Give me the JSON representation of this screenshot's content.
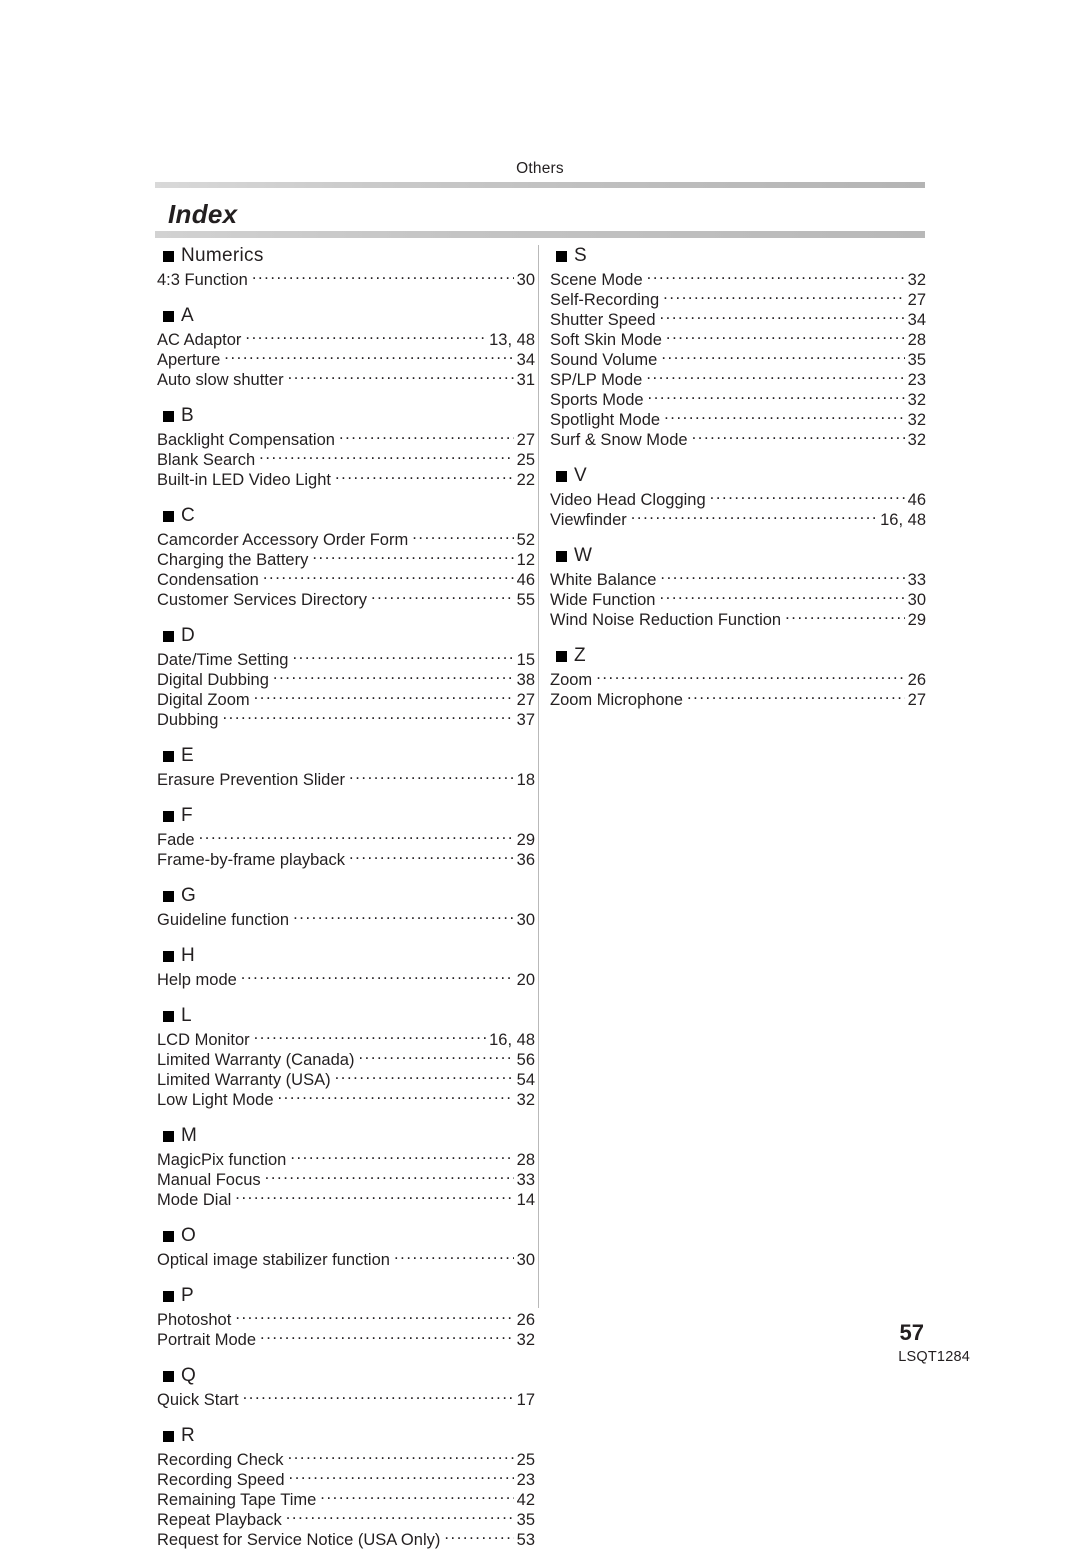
{
  "header": {
    "section_label": "Others",
    "title": "Index"
  },
  "footer": {
    "page_number": "57",
    "document_code": "LSQT1284"
  },
  "columns": [
    {
      "groups": [
        {
          "letter": "Numerics",
          "entries": [
            {
              "label": "4:3 Function",
              "page": "30"
            }
          ]
        },
        {
          "letter": "A",
          "entries": [
            {
              "label": "AC Adaptor",
              "page": "13, 48"
            },
            {
              "label": "Aperture",
              "page": "34"
            },
            {
              "label": "Auto slow shutter",
              "page": "31"
            }
          ]
        },
        {
          "letter": "B",
          "entries": [
            {
              "label": "Backlight Compensation",
              "page": "27"
            },
            {
              "label": "Blank Search",
              "page": "25"
            },
            {
              "label": "Built-in LED Video Light",
              "page": "22"
            }
          ]
        },
        {
          "letter": "C",
          "entries": [
            {
              "label": "Camcorder Accessory Order Form",
              "page": "52"
            },
            {
              "label": "Charging the Battery",
              "page": "12"
            },
            {
              "label": "Condensation",
              "page": "46"
            },
            {
              "label": "Customer Services Directory",
              "page": "55"
            }
          ]
        },
        {
          "letter": "D",
          "entries": [
            {
              "label": "Date/Time Setting",
              "page": "15"
            },
            {
              "label": "Digital Dubbing",
              "page": "38"
            },
            {
              "label": "Digital Zoom",
              "page": "27"
            },
            {
              "label": "Dubbing",
              "page": "37"
            }
          ]
        },
        {
          "letter": "E",
          "entries": [
            {
              "label": "Erasure Prevention Slider",
              "page": "18"
            }
          ]
        },
        {
          "letter": "F",
          "entries": [
            {
              "label": "Fade",
              "page": "29"
            },
            {
              "label": "Frame-by-frame playback",
              "page": "36"
            }
          ]
        },
        {
          "letter": "G",
          "entries": [
            {
              "label": "Guideline function",
              "page": "30"
            }
          ]
        },
        {
          "letter": "H",
          "entries": [
            {
              "label": "Help mode",
              "page": "20"
            }
          ]
        },
        {
          "letter": "L",
          "entries": [
            {
              "label": "LCD Monitor",
              "page": "16, 48"
            },
            {
              "label": "Limited Warranty (Canada)",
              "page": "56"
            },
            {
              "label": "Limited Warranty (USA)",
              "page": "54"
            },
            {
              "label": "Low Light Mode",
              "page": "32"
            }
          ]
        },
        {
          "letter": "M",
          "entries": [
            {
              "label": "MagicPix function",
              "page": "28"
            },
            {
              "label": "Manual Focus",
              "page": "33"
            },
            {
              "label": "Mode Dial",
              "page": "14"
            }
          ]
        },
        {
          "letter": "O",
          "entries": [
            {
              "label": "Optical image stabilizer function",
              "page": "30"
            }
          ]
        },
        {
          "letter": "P",
          "entries": [
            {
              "label": "Photoshot",
              "page": "26"
            },
            {
              "label": "Portrait Mode",
              "page": "32"
            }
          ]
        },
        {
          "letter": "Q",
          "entries": [
            {
              "label": "Quick Start",
              "page": "17"
            }
          ]
        },
        {
          "letter": "R",
          "entries": [
            {
              "label": "Recording Check",
              "page": "25"
            },
            {
              "label": "Recording Speed",
              "page": "23"
            },
            {
              "label": "Remaining Tape Time",
              "page": "42"
            },
            {
              "label": "Repeat Playback",
              "page": "35"
            },
            {
              "label": "Request for Service Notice (USA Only)",
              "page": "53"
            }
          ]
        }
      ]
    },
    {
      "groups": [
        {
          "letter": "S",
          "entries": [
            {
              "label": "Scene Mode",
              "page": "32"
            },
            {
              "label": "Self-Recording",
              "page": "27"
            },
            {
              "label": "Shutter Speed",
              "page": "34"
            },
            {
              "label": "Soft Skin Mode",
              "page": "28"
            },
            {
              "label": "Sound Volume",
              "page": "35"
            },
            {
              "label": "SP/LP Mode",
              "page": "23"
            },
            {
              "label": "Sports Mode",
              "page": "32"
            },
            {
              "label": "Spotlight Mode",
              "page": "32"
            },
            {
              "label": "Surf & Snow Mode",
              "page": "32"
            }
          ]
        },
        {
          "letter": "V",
          "entries": [
            {
              "label": "Video Head Clogging",
              "page": "46"
            },
            {
              "label": "Viewfinder",
              "page": "16, 48"
            }
          ]
        },
        {
          "letter": "W",
          "entries": [
            {
              "label": "White Balance",
              "page": "33"
            },
            {
              "label": "Wide Function",
              "page": "30"
            },
            {
              "label": "Wind Noise Reduction Function",
              "page": "29"
            }
          ]
        },
        {
          "letter": "Z",
          "entries": [
            {
              "label": "Zoom",
              "page": "26"
            },
            {
              "label": "Zoom Microphone",
              "page": "27"
            }
          ]
        }
      ]
    }
  ]
}
